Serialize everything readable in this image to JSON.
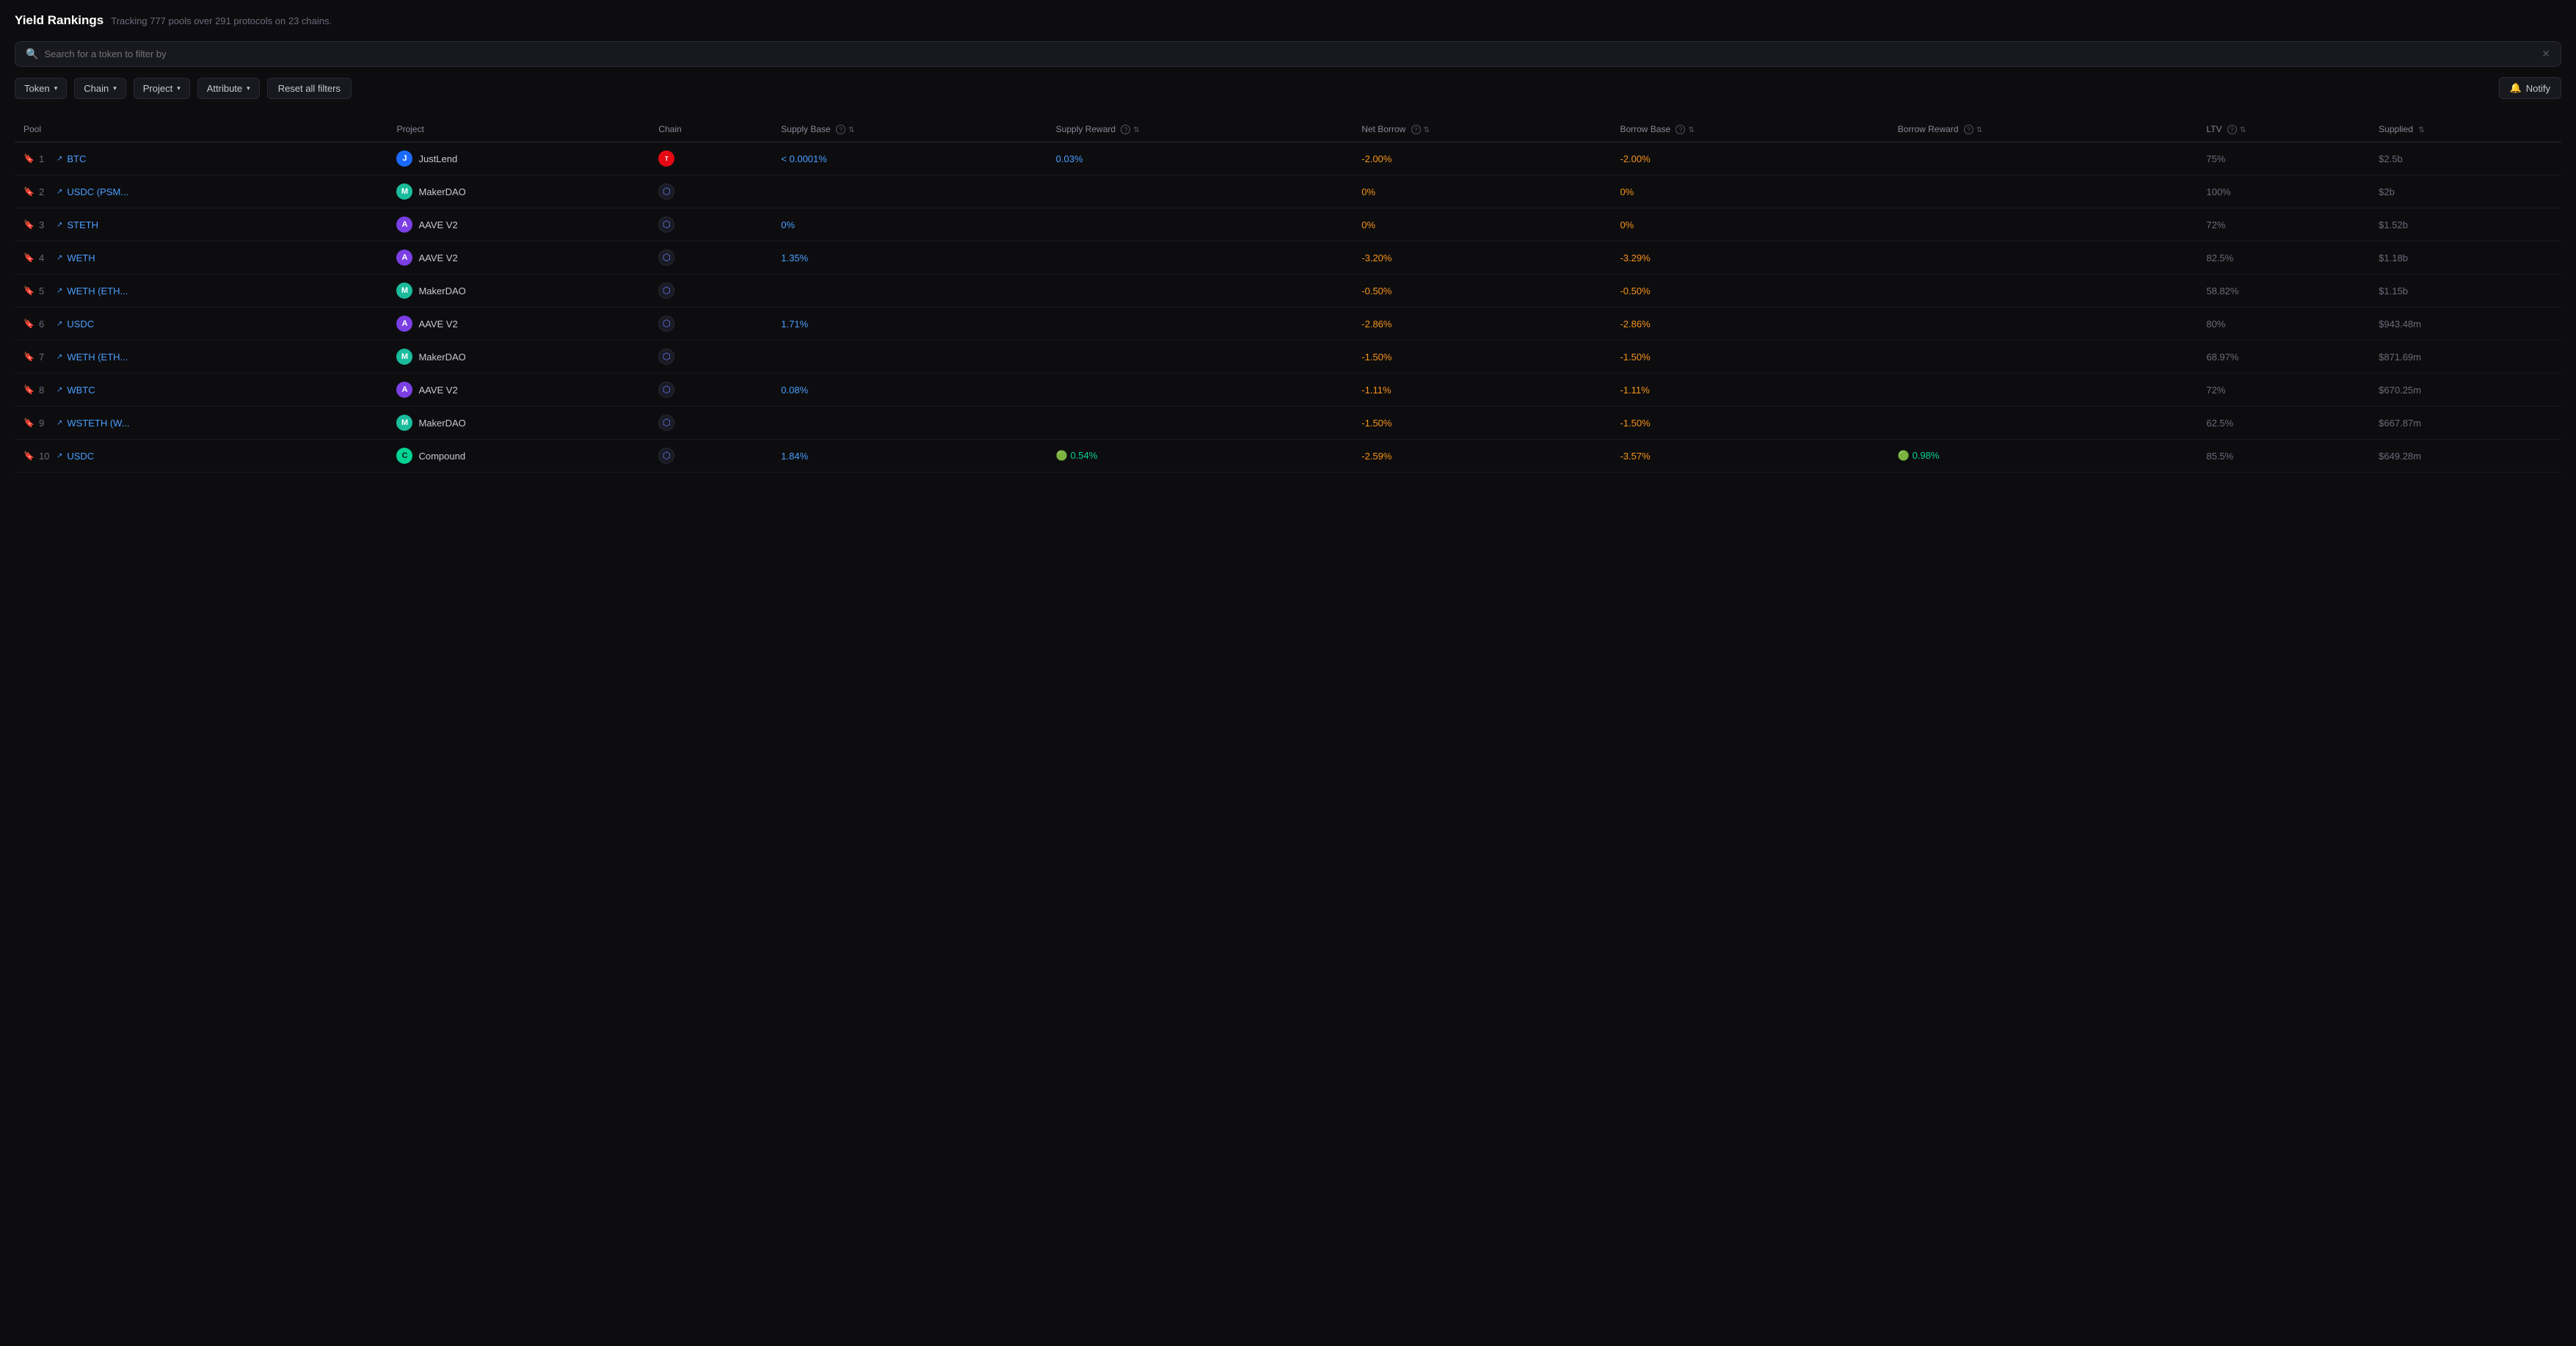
{
  "header": {
    "title": "Yield Rankings",
    "subtitle": "Tracking 777 pools over 291 protocols on 23 chains."
  },
  "search": {
    "placeholder": "Search for a token to filter by"
  },
  "filters": {
    "token_label": "Token",
    "chain_label": "Chain",
    "project_label": "Project",
    "attribute_label": "Attribute",
    "reset_label": "Reset all filters",
    "notify_label": "Notify"
  },
  "columns": [
    {
      "id": "pool",
      "label": "Pool",
      "info": false,
      "sort": false
    },
    {
      "id": "project",
      "label": "Project",
      "info": false,
      "sort": false
    },
    {
      "id": "chain",
      "label": "Chain",
      "info": false,
      "sort": false
    },
    {
      "id": "supply_base",
      "label": "Supply Base",
      "info": true,
      "sort": true
    },
    {
      "id": "supply_reward",
      "label": "Supply Reward",
      "info": true,
      "sort": true
    },
    {
      "id": "net_borrow",
      "label": "Net Borrow",
      "info": true,
      "sort": true
    },
    {
      "id": "borrow_base",
      "label": "Borrow Base",
      "info": true,
      "sort": true
    },
    {
      "id": "borrow_reward",
      "label": "Borrow Reward",
      "info": true,
      "sort": true
    },
    {
      "id": "ltv",
      "label": "LTV",
      "info": true,
      "sort": true
    },
    {
      "id": "supplied",
      "label": "Supplied",
      "info": false,
      "sort": true
    }
  ],
  "rows": [
    {
      "rank": 1,
      "token": "BTC",
      "project": "JustLend",
      "project_class": "logo-justlend",
      "project_letter": "J",
      "chain": "tron",
      "supply_base": "< 0.0001%",
      "supply_base_class": "val-blue",
      "supply_reward": "0.03%",
      "supply_reward_class": "val-blue",
      "net_borrow": "-2.00%",
      "net_borrow_class": "val-orange",
      "borrow_base": "-2.00%",
      "borrow_base_class": "val-orange",
      "borrow_reward": "",
      "borrow_reward_class": "",
      "ltv": "75%",
      "ltv_class": "val-gray",
      "supplied": "$2.5b",
      "supplied_class": "val-gray"
    },
    {
      "rank": 2,
      "token": "USDC (PSM...",
      "project": "MakerDAO",
      "project_class": "logo-makerdao",
      "project_letter": "M",
      "chain": "eth",
      "supply_base": "",
      "supply_base_class": "",
      "supply_reward": "",
      "supply_reward_class": "",
      "net_borrow": "0%",
      "net_borrow_class": "val-orange",
      "borrow_base": "0%",
      "borrow_base_class": "val-orange",
      "borrow_reward": "",
      "borrow_reward_class": "",
      "ltv": "100%",
      "ltv_class": "val-gray",
      "supplied": "$2b",
      "supplied_class": "val-gray"
    },
    {
      "rank": 3,
      "token": "STETH",
      "project": "AAVE V2",
      "project_class": "logo-aave",
      "project_letter": "A",
      "chain": "eth",
      "supply_base": "0%",
      "supply_base_class": "val-blue",
      "supply_reward": "",
      "supply_reward_class": "",
      "net_borrow": "0%",
      "net_borrow_class": "val-orange",
      "borrow_base": "0%",
      "borrow_base_class": "val-orange",
      "borrow_reward": "",
      "borrow_reward_class": "",
      "ltv": "72%",
      "ltv_class": "val-gray",
      "supplied": "$1.52b",
      "supplied_class": "val-gray"
    },
    {
      "rank": 4,
      "token": "WETH",
      "project": "AAVE V2",
      "project_class": "logo-aave",
      "project_letter": "A",
      "chain": "eth",
      "supply_base": "1.35%",
      "supply_base_class": "val-blue",
      "supply_reward": "",
      "supply_reward_class": "",
      "net_borrow": "-3.20%",
      "net_borrow_class": "val-orange",
      "borrow_base": "-3.29%",
      "borrow_base_class": "val-orange",
      "borrow_reward": "",
      "borrow_reward_class": "",
      "ltv": "82.5%",
      "ltv_class": "val-gray",
      "supplied": "$1.18b",
      "supplied_class": "val-gray"
    },
    {
      "rank": 5,
      "token": "WETH (ETH...",
      "project": "MakerDAO",
      "project_class": "logo-makerdao",
      "project_letter": "M",
      "chain": "eth",
      "supply_base": "",
      "supply_base_class": "",
      "supply_reward": "",
      "supply_reward_class": "",
      "net_borrow": "-0.50%",
      "net_borrow_class": "val-orange",
      "borrow_base": "-0.50%",
      "borrow_base_class": "val-orange",
      "borrow_reward": "",
      "borrow_reward_class": "",
      "ltv": "58.82%",
      "ltv_class": "val-gray",
      "supplied": "$1.15b",
      "supplied_class": "val-gray"
    },
    {
      "rank": 6,
      "token": "USDC",
      "project": "AAVE V2",
      "project_class": "logo-aave",
      "project_letter": "A",
      "chain": "eth",
      "supply_base": "1.71%",
      "supply_base_class": "val-blue",
      "supply_reward": "",
      "supply_reward_class": "",
      "net_borrow": "-2.86%",
      "net_borrow_class": "val-orange",
      "borrow_base": "-2.86%",
      "borrow_base_class": "val-orange",
      "borrow_reward": "",
      "borrow_reward_class": "",
      "ltv": "80%",
      "ltv_class": "val-gray",
      "supplied": "$943.48m",
      "supplied_class": "val-gray"
    },
    {
      "rank": 7,
      "token": "WETH (ETH...",
      "project": "MakerDAO",
      "project_class": "logo-makerdao",
      "project_letter": "M",
      "chain": "eth",
      "supply_base": "",
      "supply_base_class": "",
      "supply_reward": "",
      "supply_reward_class": "",
      "net_borrow": "-1.50%",
      "net_borrow_class": "val-orange",
      "borrow_base": "-1.50%",
      "borrow_base_class": "val-orange",
      "borrow_reward": "",
      "borrow_reward_class": "",
      "ltv": "68.97%",
      "ltv_class": "val-gray",
      "supplied": "$871.69m",
      "supplied_class": "val-gray"
    },
    {
      "rank": 8,
      "token": "WBTC",
      "project": "AAVE V2",
      "project_class": "logo-aave",
      "project_letter": "A",
      "chain": "eth",
      "supply_base": "0.08%",
      "supply_base_class": "val-blue",
      "supply_reward": "",
      "supply_reward_class": "",
      "net_borrow": "-1.11%",
      "net_borrow_class": "val-orange",
      "borrow_base": "-1.11%",
      "borrow_base_class": "val-orange",
      "borrow_reward": "",
      "borrow_reward_class": "",
      "ltv": "72%",
      "ltv_class": "val-gray",
      "supplied": "$670.25m",
      "supplied_class": "val-gray"
    },
    {
      "rank": 9,
      "token": "WSTETH (W...",
      "project": "MakerDAO",
      "project_class": "logo-makerdao",
      "project_letter": "M",
      "chain": "eth",
      "supply_base": "",
      "supply_base_class": "",
      "supply_reward": "",
      "supply_reward_class": "",
      "net_borrow": "-1.50%",
      "net_borrow_class": "val-orange",
      "borrow_base": "-1.50%",
      "borrow_base_class": "val-orange",
      "borrow_reward": "",
      "borrow_reward_class": "",
      "ltv": "62.5%",
      "ltv_class": "val-gray",
      "supplied": "$667.87m",
      "supplied_class": "val-gray"
    },
    {
      "rank": 10,
      "token": "USDC",
      "project": "Compound",
      "project_class": "logo-compound",
      "project_letter": "C",
      "chain": "eth",
      "supply_base": "1.84%",
      "supply_base_class": "val-blue",
      "supply_reward": "0.54%",
      "supply_reward_class": "val-green",
      "supply_reward_has_icon": true,
      "net_borrow": "-2.59%",
      "net_borrow_class": "val-orange",
      "borrow_base": "-3.57%",
      "borrow_base_class": "val-orange",
      "borrow_reward": "0.98%",
      "borrow_reward_class": "val-green",
      "borrow_reward_has_icon": true,
      "ltv": "85.5%",
      "ltv_class": "val-gray",
      "supplied": "$649.28m",
      "supplied_class": "val-gray"
    }
  ]
}
